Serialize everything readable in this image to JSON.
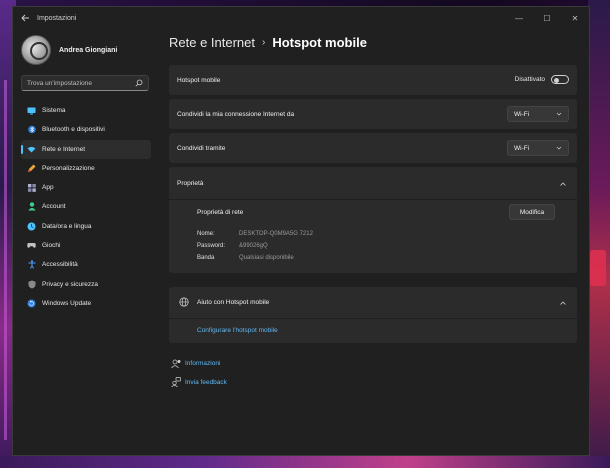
{
  "window": {
    "app_title": "Impostazioni",
    "controls": {
      "minimize": "—",
      "maximize": "☐",
      "close": "✕"
    }
  },
  "sidebar": {
    "user_name": "Andrea Giongiani",
    "search_placeholder": "Trova un'impostazione",
    "items": [
      {
        "label": "Sistema",
        "icon": "display-icon",
        "color": "#4cc2ff",
        "active": false
      },
      {
        "label": "Bluetooth e dispositivi",
        "icon": "bluetooth-icon",
        "color": "#4c9cff",
        "active": false
      },
      {
        "label": "Rete e Internet",
        "icon": "wifi-icon",
        "color": "#4cc2ff",
        "active": true
      },
      {
        "label": "Personalizzazione",
        "icon": "pencil-icon",
        "color": "#f2a33a",
        "active": false
      },
      {
        "label": "App",
        "icon": "apps-icon",
        "color": "#b0b0d0",
        "active": false
      },
      {
        "label": "Account",
        "icon": "person-icon",
        "color": "#3ccf8a",
        "active": false
      },
      {
        "label": "Data/ora e lingua",
        "icon": "globe-clock-icon",
        "color": "#4cc2ff",
        "active": false
      },
      {
        "label": "Giochi",
        "icon": "gamepad-icon",
        "color": "#c0c0c0",
        "active": false
      },
      {
        "label": "Accessibilità",
        "icon": "accessibility-icon",
        "color": "#4c9cff",
        "active": false
      },
      {
        "label": "Privacy e sicurezza",
        "icon": "shield-icon",
        "color": "#8a8a8a",
        "active": false
      },
      {
        "label": "Windows Update",
        "icon": "update-icon",
        "color": "#4cc2ff",
        "active": false
      }
    ]
  },
  "breadcrumb": {
    "parent": "Rete e Internet",
    "separator": "›",
    "current": "Hotspot mobile"
  },
  "hotspot": {
    "label": "Hotspot mobile",
    "state_text": "Disattivato",
    "enabled": false
  },
  "share_from": {
    "label": "Condividi la mia connessione Internet da",
    "value": "Wi-Fi"
  },
  "share_over": {
    "label": "Condividi tramite",
    "value": "Wi-Fi"
  },
  "properties": {
    "title": "Proprietà",
    "subtitle": "Proprietà di rete",
    "edit_label": "Modifica",
    "fields": [
      {
        "key": "Nome:",
        "value": "DESKTOP-Q0M9A5G 7212"
      },
      {
        "key": "Password:",
        "value": "&99026gQ"
      },
      {
        "key": "Banda",
        "value": "Qualsiasi disponibile"
      }
    ]
  },
  "help": {
    "title": "Aiuto con Hotspot mobile",
    "link": "Configurare l'hotspot mobile"
  },
  "footer": {
    "info": "Informazioni",
    "feedback": "Invia feedback"
  },
  "accent_color": "#4cc2ff"
}
